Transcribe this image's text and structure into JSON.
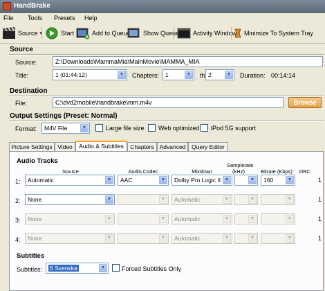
{
  "window": {
    "title": "HandBrake"
  },
  "menu": [
    "File",
    "Tools",
    "Presets",
    "Help"
  ],
  "toolbar": {
    "source": "Source",
    "start": "Start",
    "add_queue": "Add to Queue",
    "show_queue": "Show Queue",
    "activity": "Activity Window",
    "minimize": "Minimize To System Tray"
  },
  "source_section": {
    "heading": "Source",
    "source_label": "Source:",
    "source_path": "Z:\\Downloads\\MammaMia\\MainMovie\\MAMMA_MIA",
    "title_label": "Title:",
    "title_value": "1 (01:44:12)",
    "chapters_label": "Chapters:",
    "chapter_start": "1",
    "through_label": "through",
    "chapter_end": "2",
    "duration_label": "Duration:",
    "duration_value": "00:14:14"
  },
  "destination": {
    "heading": "Destination",
    "file_label": "File:",
    "file_path": "C:\\dvd2mobile\\handbrake\\mm.m4v",
    "browse": "Browse"
  },
  "output": {
    "heading": "Output Settings (Preset: Normal)",
    "format_label": "Format:",
    "format_value": "M4V File",
    "large_file": "Large file size",
    "web_optimized": "Web optimized",
    "ipod": "iPod 5G support"
  },
  "tabs": [
    "Picture Settings",
    "Video",
    "Audio & Subtitles",
    "Chapters",
    "Advanced",
    "Query Editor"
  ],
  "active_tab": "Audio & Subtitles",
  "audio": {
    "heading": "Audio Tracks",
    "col_source": "Source",
    "col_codec": "Audio Codec",
    "col_mixdown": "Mixdown",
    "col_samplerate_1": "Samplerate",
    "col_samplerate_2": "(kHz)",
    "col_bitrate": "Bitrate (Kbps)",
    "col_drc": "DRC",
    "tracks": [
      {
        "num": "1:",
        "source": "Automatic",
        "codec": "AAC",
        "mixdown": "Dolby Pro Logic II",
        "samplerate": "",
        "bitrate": "160",
        "drc": "1",
        "enabled": true
      },
      {
        "num": "2:",
        "source": "None",
        "codec": "",
        "mixdown": "Automatic",
        "samplerate": "",
        "bitrate": "",
        "drc": "1",
        "enabled": false
      },
      {
        "num": "3:",
        "source": "None",
        "codec": "",
        "mixdown": "Automatic",
        "samplerate": "",
        "bitrate": "",
        "drc": "1",
        "enabled": false
      },
      {
        "num": "4:",
        "source": "None",
        "codec": "",
        "mixdown": "Automatic",
        "samplerate": "",
        "bitrate": "",
        "drc": "1",
        "enabled": false
      }
    ]
  },
  "subtitles": {
    "heading": "Subtitles",
    "label": "Subtitles:",
    "value": "6 Svenska",
    "forced": "Forced Subtitles Only"
  },
  "colors": {
    "accent_tab": "#f5a623",
    "select_highlight": "#316ac5"
  }
}
